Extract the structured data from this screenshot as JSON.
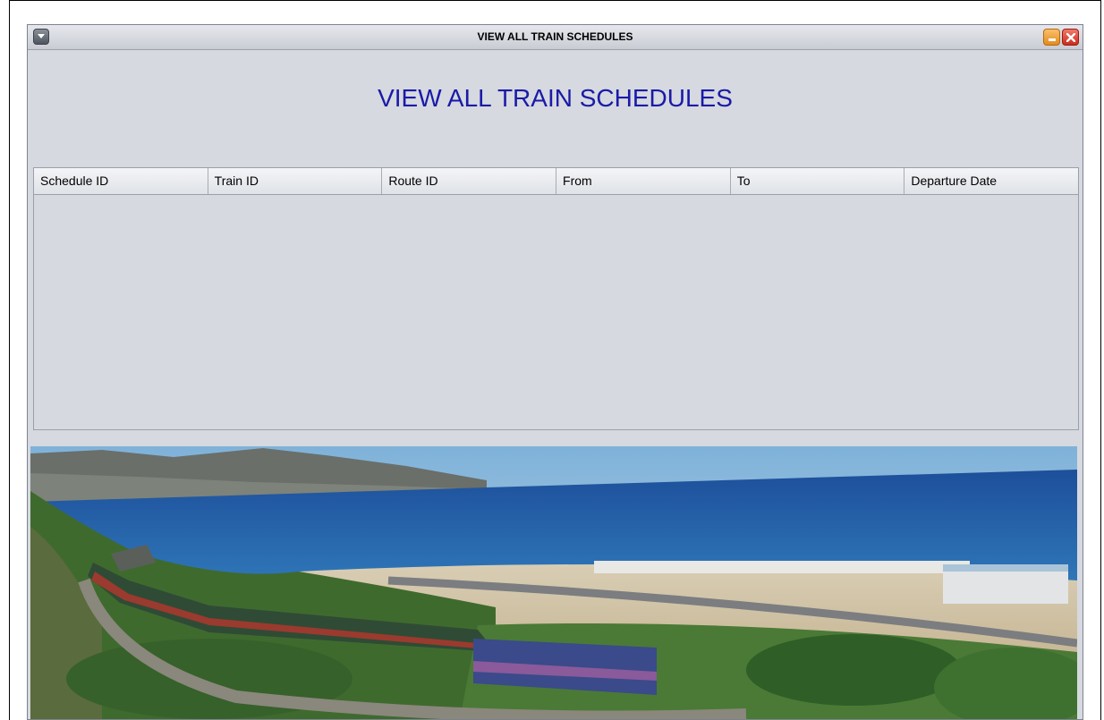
{
  "window": {
    "title": "VIEW ALL TRAIN SCHEDULES"
  },
  "heading": "VIEW ALL TRAIN SCHEDULES",
  "table": {
    "columns": [
      "Schedule ID",
      "Train ID",
      "Route ID",
      "From",
      "To",
      "Departure Date"
    ],
    "rows": []
  },
  "colors": {
    "heading": "#1a1aa8",
    "window_bg": "#d6d9df",
    "minimize_button": "#e58b1e",
    "close_button": "#cc2c1d"
  },
  "icons": {
    "system_menu": "chevron-down-icon",
    "minimize": "minimize-icon",
    "close": "close-icon"
  }
}
